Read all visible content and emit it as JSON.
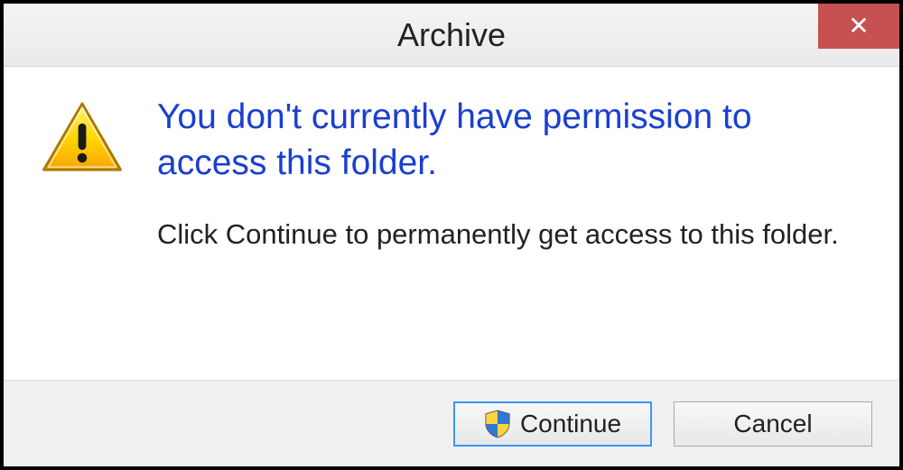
{
  "titlebar": {
    "title": "Archive",
    "close_glyph": "✕"
  },
  "content": {
    "heading": "You don't currently have permission to access this folder.",
    "body": "Click Continue to permanently get access to this folder."
  },
  "buttons": {
    "continue_label": "Continue",
    "cancel_label": "Cancel"
  }
}
